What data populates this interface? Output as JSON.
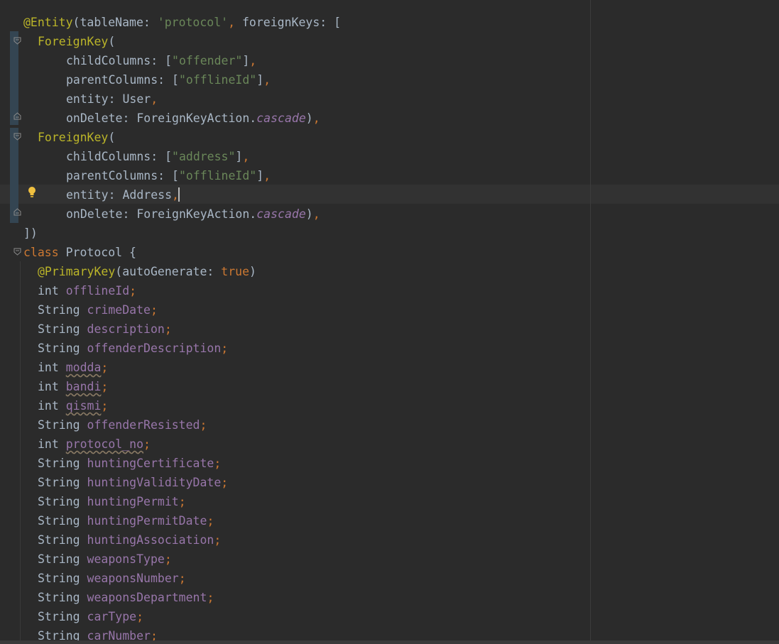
{
  "colors": {
    "background": "#2b2b2b",
    "text": "#a9b7c6",
    "keyword": "#cc7832",
    "annotation": "#bbb529",
    "string": "#6a8759",
    "field": "#9876aa",
    "caret_line": "#323232",
    "gutter_highlight": "#344552",
    "bulb": "#f0c040"
  },
  "icons": {
    "fold_open": "fold-open-icon",
    "fold_close": "fold-close-icon",
    "intention": "lightbulb-icon"
  },
  "code": {
    "l1": {
      "a": "@Entity",
      "b": "(tableName: ",
      "c": "'protocol'",
      "d": ", ",
      "e": "foreignKeys: ["
    },
    "l2": {
      "a": "ForeignKey",
      "b": "("
    },
    "l3": {
      "a": "childColumns: [",
      "b": "\"offender\"",
      "c": "]",
      "d": ","
    },
    "l4": {
      "a": "parentColumns: [",
      "b": "\"offlineId\"",
      "c": "]",
      "d": ","
    },
    "l5": {
      "a": "entity: User",
      "b": ","
    },
    "l6": {
      "a": "onDelete: ForeignKeyAction.",
      "b": "cascade",
      "c": ")",
      "d": ","
    },
    "l7": {
      "a": "ForeignKey",
      "b": "("
    },
    "l8": {
      "a": "childColumns: [",
      "b": "\"address\"",
      "c": "]",
      "d": ","
    },
    "l9": {
      "a": "parentColumns: [",
      "b": "\"offlineId\"",
      "c": "]",
      "d": ","
    },
    "l10": {
      "a": "entity: Address",
      "b": ","
    },
    "l11": {
      "a": "onDelete: ForeignKeyAction.",
      "b": "cascade",
      "c": ")",
      "d": ","
    },
    "l12": {
      "a": "])"
    },
    "l13": {
      "a": "class",
      "b": " Protocol {"
    },
    "l14": {
      "a": "@PrimaryKey",
      "b": "(autoGenerate: ",
      "c": "true",
      "d": ")"
    },
    "fields": [
      {
        "type": "int",
        "name": "offlineId"
      },
      {
        "type": "String",
        "name": "crimeDate"
      },
      {
        "type": "String",
        "name": "description"
      },
      {
        "type": "String",
        "name": "offenderDescription"
      },
      {
        "type": "int",
        "name": "modda"
      },
      {
        "type": "int",
        "name": "bandi"
      },
      {
        "type": "int",
        "name": "qismi"
      },
      {
        "type": "String",
        "name": "offenderResisted"
      },
      {
        "type": "int",
        "name": "protocol_no"
      },
      {
        "type": "String",
        "name": "huntingCertificate"
      },
      {
        "type": "String",
        "name": "huntingValidityDate"
      },
      {
        "type": "String",
        "name": "huntingPermit"
      },
      {
        "type": "String",
        "name": "huntingPermitDate"
      },
      {
        "type": "String",
        "name": "huntingAssociation"
      },
      {
        "type": "String",
        "name": "weaponsType"
      },
      {
        "type": "String",
        "name": "weaponsNumber"
      },
      {
        "type": "String",
        "name": "weaponsDepartment"
      },
      {
        "type": "String",
        "name": "carType"
      },
      {
        "type": "String",
        "name": "carNumber"
      }
    ],
    "semicolon": ";"
  }
}
